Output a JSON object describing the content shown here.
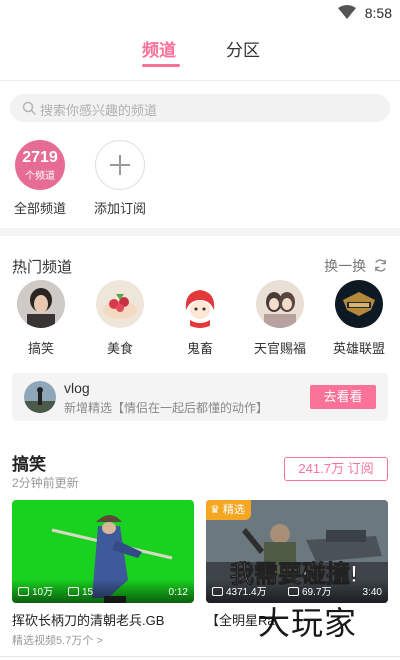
{
  "status_bar": {
    "time": "8:58",
    "icons": [
      "wifi-icon"
    ]
  },
  "top_tabs": [
    {
      "label": "频道",
      "active": true
    },
    {
      "label": "分区",
      "active": false
    }
  ],
  "search": {
    "placeholder": "搜索你感兴趣的频道",
    "icon": "search-icon"
  },
  "subscriptions": {
    "all": {
      "count": "2719",
      "unit": "个频道",
      "label": "全部频道"
    },
    "add": {
      "label": "添加订阅",
      "icon": "plus-icon"
    }
  },
  "hot": {
    "title": "热门频道",
    "refresh_label": "换一换",
    "channels": [
      {
        "label": "搞笑"
      },
      {
        "label": "美食"
      },
      {
        "label": "鬼畜"
      },
      {
        "label": "天官赐福"
      },
      {
        "label": "英雄联盟"
      }
    ]
  },
  "vlog": {
    "name": "vlog",
    "desc": "新增精选【情侣在一起后都懂的动作】",
    "button": "去看看"
  },
  "section": {
    "title": "搞笑",
    "updated": "2分钟前更新",
    "subscribe": "241.7万 订阅",
    "videos": [
      {
        "plays": "10万",
        "danmaku": "15",
        "duration": "0:12",
        "title": "挥砍长柄刀的清朝老兵.GB",
        "sub": "精选视频5.7万个 >",
        "badge": ""
      },
      {
        "plays": "4371.4万",
        "danmaku": "69.7万",
        "duration": "3:40",
        "title": "【全明星Ra",
        "sub": "",
        "badge": "精选",
        "overlay_text": "我需要碰撞!"
      }
    ]
  },
  "watermark": "大玩家",
  "colors": {
    "accent": "#fb7299",
    "all_channel_circle": "#e66b95",
    "badge": "#f5a623"
  }
}
